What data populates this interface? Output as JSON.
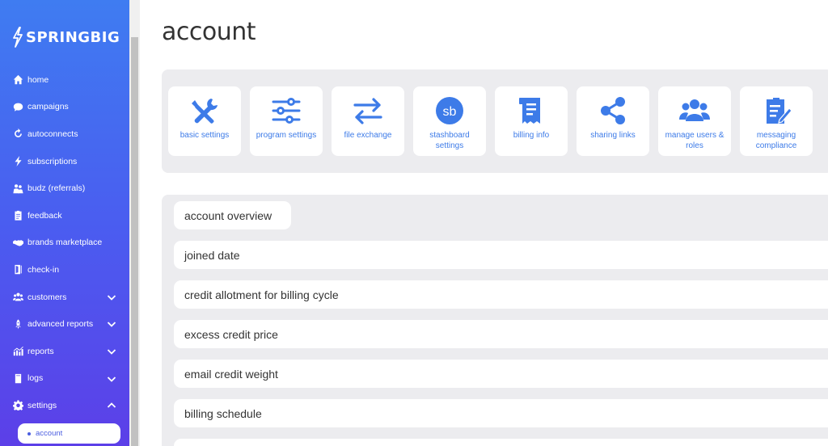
{
  "brand": {
    "name": "SPRINGBIG"
  },
  "sidebar": {
    "items": [
      {
        "label": "home",
        "icon": "home-icon"
      },
      {
        "label": "campaigns",
        "icon": "chat-icon"
      },
      {
        "label": "autoconnects",
        "icon": "refresh-icon"
      },
      {
        "label": "subscriptions",
        "icon": "bolt-icon"
      },
      {
        "label": "budz (referrals)",
        "icon": "people-icon"
      },
      {
        "label": "feedback",
        "icon": "clipboard-icon"
      },
      {
        "label": "brands marketplace",
        "icon": "handshake-icon"
      },
      {
        "label": "check-in",
        "icon": "door-icon"
      },
      {
        "label": "customers",
        "icon": "users-icon",
        "expandable": true
      },
      {
        "label": "advanced reports",
        "icon": "rocket-icon",
        "expandable": true
      },
      {
        "label": "reports",
        "icon": "chart-icon",
        "expandable": true
      },
      {
        "label": "logs",
        "icon": "log-icon",
        "expandable": true
      },
      {
        "label": "settings",
        "icon": "gear-icon",
        "expanded": true
      }
    ],
    "active_sub_item": "account"
  },
  "main": {
    "title": "account",
    "tiles": [
      {
        "label": "basic settings",
        "icon": "tools-icon"
      },
      {
        "label": "program settings",
        "icon": "sliders-icon"
      },
      {
        "label": "file exchange",
        "icon": "exchange-icon"
      },
      {
        "label": "stashboard settings",
        "icon": "sb-icon"
      },
      {
        "label": "billing info",
        "icon": "receipt-icon"
      },
      {
        "label": "sharing links",
        "icon": "share-icon"
      },
      {
        "label": "manage users & roles",
        "icon": "users-icon"
      },
      {
        "label": "messaging compliance",
        "icon": "compliance-icon"
      }
    ],
    "rows": [
      "account overview",
      "joined date",
      "credit allotment for billing cycle",
      "excess credit price",
      "email credit weight",
      "billing schedule"
    ]
  },
  "colors": {
    "accent": "#3d7be8",
    "sidebar_top": "#3f7cf1",
    "sidebar_bottom": "#5c3fe8",
    "panel": "#ececef"
  }
}
